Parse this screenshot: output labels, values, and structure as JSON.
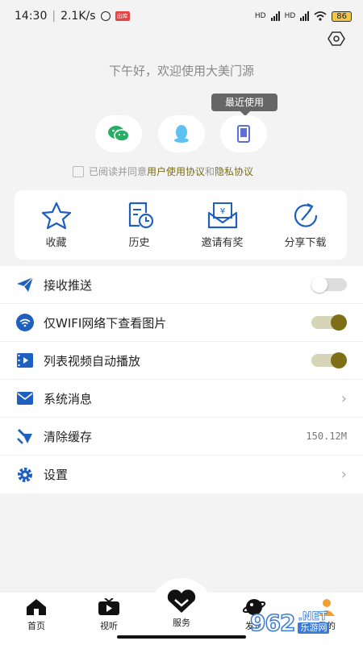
{
  "status": {
    "time": "14:30",
    "speed": "2.1K/s",
    "badge": "出库",
    "battery": "86"
  },
  "greeting": "下午好，欢迎使用大美门源",
  "recent_badge": "最近使用",
  "login_options": [
    {
      "icon": "wechat-icon",
      "color": "#2aae67"
    },
    {
      "icon": "qq-icon",
      "color": "#5fc1f0"
    },
    {
      "icon": "phone-icon",
      "color": "#5b6fd6"
    }
  ],
  "agreement": {
    "prefix": "已阅读并同意",
    "user_terms": "用户使用协议",
    "and": "和",
    "privacy": "隐私协议",
    "link_color": "#7a6d1c"
  },
  "quick_actions": [
    {
      "icon": "star-icon",
      "label": "收藏"
    },
    {
      "icon": "history-icon",
      "label": "历史"
    },
    {
      "icon": "invite-reward-icon",
      "label": "邀请有奖"
    },
    {
      "icon": "share-icon",
      "label": "分享下载"
    }
  ],
  "settings": [
    {
      "icon": "send-icon",
      "label": "接收推送",
      "type": "toggle",
      "on": false
    },
    {
      "icon": "wifi-icon",
      "label": "仅WIFI网络下查看图片",
      "type": "toggle",
      "on": true
    },
    {
      "icon": "video-icon",
      "label": "列表视频自动播放",
      "type": "toggle",
      "on": true
    },
    {
      "icon": "mail-icon",
      "label": "系统消息",
      "type": "link"
    },
    {
      "icon": "broom-icon",
      "label": "清除缓存",
      "type": "value",
      "value": "150.12M"
    },
    {
      "icon": "gear-icon",
      "label": "设置",
      "type": "link"
    }
  ],
  "tabs": [
    {
      "icon": "home-icon",
      "label": "首页"
    },
    {
      "icon": "tv-icon",
      "label": "视听"
    },
    {
      "icon": "heart-icon",
      "label": "服务"
    },
    {
      "icon": "discover-icon",
      "label": "发现"
    },
    {
      "icon": "profile-icon",
      "label": "我的"
    }
  ],
  "watermark": {
    "number": "962",
    "suffix": ".NET",
    "site": "乐游网"
  },
  "colors": {
    "accent": "#7d7018",
    "icon_blue": "#1f5fbf"
  }
}
